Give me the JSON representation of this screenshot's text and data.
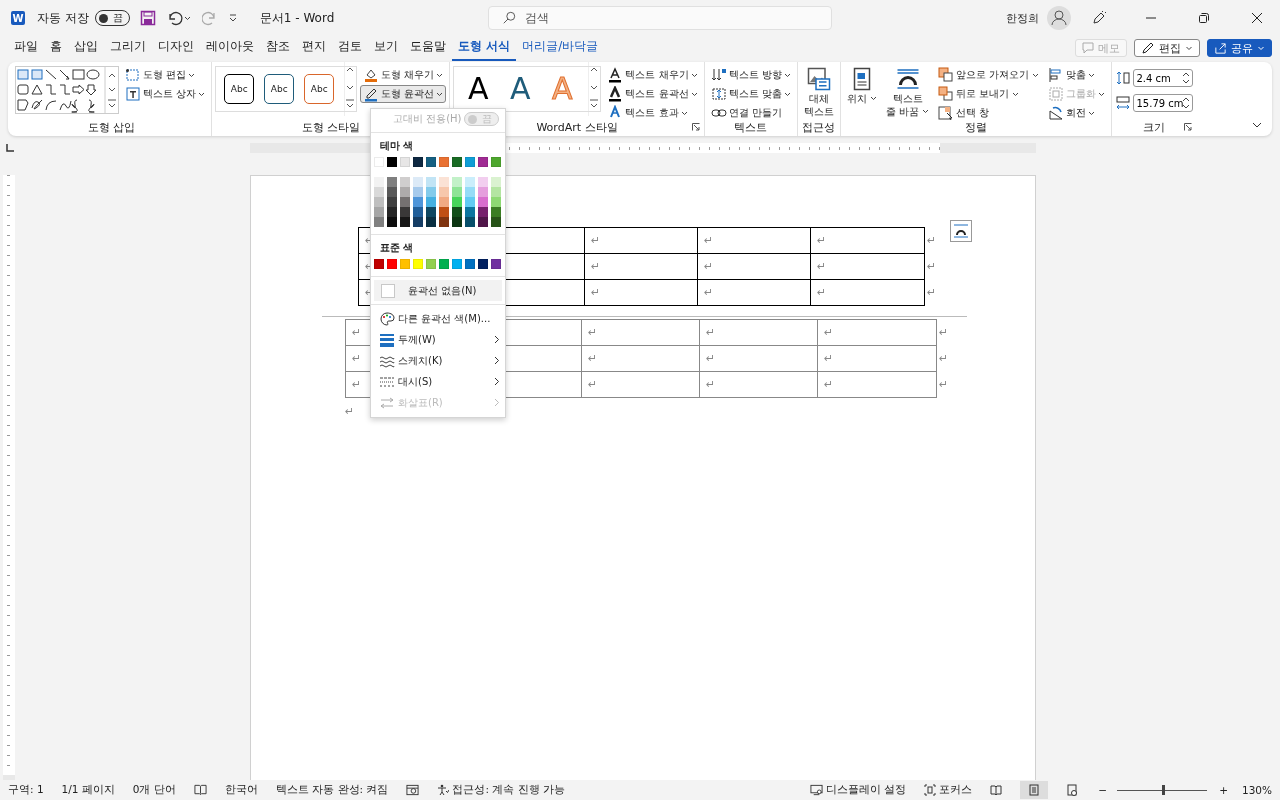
{
  "title_bar": {
    "logo_letter": "W",
    "autosave_label": "자동 저장",
    "autosave_toggle": {
      "label": "끔",
      "on": false
    },
    "document_title": "문서1  -  Word",
    "search": {
      "placeholder": "검색"
    },
    "user_name": "한정희"
  },
  "tabs": [
    {
      "label": "파일",
      "selected": false,
      "kind": "normal"
    },
    {
      "label": "홈",
      "selected": false,
      "kind": "normal"
    },
    {
      "label": "삽입",
      "selected": false,
      "kind": "normal"
    },
    {
      "label": "그리기",
      "selected": false,
      "kind": "normal"
    },
    {
      "label": "디자인",
      "selected": false,
      "kind": "normal"
    },
    {
      "label": "레이아웃",
      "selected": false,
      "kind": "normal"
    },
    {
      "label": "참조",
      "selected": false,
      "kind": "normal"
    },
    {
      "label": "편지",
      "selected": false,
      "kind": "normal"
    },
    {
      "label": "검토",
      "selected": false,
      "kind": "normal"
    },
    {
      "label": "보기",
      "selected": false,
      "kind": "normal"
    },
    {
      "label": "도움말",
      "selected": false,
      "kind": "normal"
    },
    {
      "label": "도형 서식",
      "selected": true,
      "kind": "contextual"
    },
    {
      "label": "머리글/바닥글",
      "selected": false,
      "kind": "contextual"
    }
  ],
  "actions": [
    {
      "label": "메모",
      "kind": "comment",
      "disabled": true
    },
    {
      "label": "편집",
      "kind": "edit",
      "disabled": false
    },
    {
      "label": "공유",
      "kind": "share",
      "disabled": false
    }
  ],
  "ribbon": {
    "groups": [
      {
        "label": "도형 삽입",
        "launcher": false,
        "columns": [
          [
            {
              "kind": "shape-gallery"
            }
          ],
          [
            {
              "kind": "button",
              "text": "도형 편집",
              "dropdown": true,
              "pressed": false,
              "disabled": false
            },
            {
              "kind": "button",
              "text": "텍스트 상자",
              "dropdown": true,
              "pressed": false,
              "disabled": false
            }
          ]
        ]
      },
      {
        "label": "도형 스타일",
        "launcher": false,
        "columns": [
          [
            {
              "kind": "style-gallery",
              "styles": [
                {
                  "text": "Abc",
                  "color": "#000000"
                },
                {
                  "text": "Abc",
                  "color": "#1f5c7a"
                },
                {
                  "text": "Abc",
                  "color": "#d9662b"
                }
              ]
            }
          ],
          [
            {
              "kind": "button",
              "text": "도형 채우기",
              "dropdown": true,
              "pressed": false,
              "disabled": false
            },
            {
              "kind": "button",
              "text": "도형 윤곽선",
              "dropdown": true,
              "pressed": true,
              "disabled": false
            }
          ]
        ]
      },
      {
        "label": "WordArt 스타일",
        "launcher": true,
        "columns": [
          [
            {
              "kind": "wordart-gallery",
              "letters": [
                {
                  "text": "A",
                  "color": "#000000",
                  "kind": "solid"
                },
                {
                  "text": "A",
                  "color": "#1f5c7a",
                  "kind": "solid"
                },
                {
                  "text": "A",
                  "color": "#f4b183",
                  "kind": "outline"
                }
              ]
            }
          ],
          [
            {
              "kind": "button",
              "text": "텍스트 채우기",
              "dropdown": true,
              "pressed": false,
              "disabled": false
            },
            {
              "kind": "button",
              "text": "텍스트 윤곽선",
              "dropdown": true,
              "pressed": false,
              "disabled": false
            },
            {
              "kind": "button",
              "text": "텍스트 효과",
              "dropdown": true,
              "pressed": false,
              "disabled": false
            }
          ]
        ]
      },
      {
        "label": "텍스트",
        "launcher": false,
        "columns": [
          [
            {
              "kind": "button",
              "text": "텍스트 방향",
              "dropdown": true,
              "pressed": false,
              "disabled": false
            },
            {
              "kind": "button",
              "text": "텍스트 맞춤",
              "dropdown": true,
              "pressed": false,
              "disabled": false
            },
            {
              "kind": "button",
              "text": "연결 만들기",
              "dropdown": false,
              "pressed": false,
              "disabled": false
            }
          ]
        ]
      },
      {
        "label": "접근성",
        "launcher": false,
        "columns": [
          [
            {
              "kind": "large-button",
              "lines": [
                "대체",
                "텍스트"
              ],
              "dropdown": false,
              "pressed": false,
              "disabled": false
            }
          ]
        ]
      },
      {
        "label": "정렬",
        "launcher": false,
        "columns": [
          [
            {
              "kind": "large-button",
              "lines": [
                "위치"
              ],
              "dropdown": true,
              "pressed": false,
              "disabled": false
            }
          ],
          [
            {
              "kind": "large-button",
              "lines": [
                "텍스트",
                "줄 바꿈"
              ],
              "dropdown": true,
              "pressed": false,
              "disabled": false
            }
          ],
          [
            {
              "kind": "button",
              "text": "앞으로 가져오기",
              "dropdown": true,
              "pressed": false,
              "disabled": false
            },
            {
              "kind": "button",
              "text": "뒤로 보내기",
              "dropdown": true,
              "pressed": false,
              "disabled": false
            },
            {
              "kind": "button",
              "text": "선택 창",
              "dropdown": false,
              "pressed": false,
              "disabled": false
            }
          ],
          [
            {
              "kind": "button",
              "text": "맞춤",
              "dropdown": true,
              "pressed": false,
              "disabled": false
            },
            {
              "kind": "button",
              "text": "그룹화",
              "dropdown": true,
              "pressed": false,
              "disabled": true
            },
            {
              "kind": "button",
              "text": "회전",
              "dropdown": true,
              "pressed": false,
              "disabled": false
            }
          ]
        ]
      },
      {
        "label": "크기",
        "launcher": true,
        "columns": [
          [
            {
              "kind": "field",
              "value": "2.4 cm"
            },
            {
              "kind": "field",
              "value": "15.79 cm"
            }
          ]
        ]
      }
    ]
  },
  "menu": {
    "high_contrast": {
      "label": "고대비 전용(H)",
      "toggle": "끔",
      "on": false,
      "disabled": true
    },
    "theme_heading": "테마 색",
    "theme_colors": [
      {
        "color": "#ffffff",
        "shades": [
          {
            "color": "#f2f2f2"
          },
          {
            "color": "#d9d9d9"
          },
          {
            "color": "#bfbfbf"
          },
          {
            "color": "#a6a6a6"
          },
          {
            "color": "#808080"
          }
        ]
      },
      {
        "color": "#000000",
        "shades": [
          {
            "color": "#7f7f7f"
          },
          {
            "color": "#595959"
          },
          {
            "color": "#404040"
          },
          {
            "color": "#262626"
          },
          {
            "color": "#0d0d0d"
          }
        ]
      },
      {
        "color": "#e7e6e6",
        "shades": [
          {
            "color": "#d0cece"
          },
          {
            "color": "#aeabab"
          },
          {
            "color": "#757171"
          },
          {
            "color": "#3a3838"
          },
          {
            "color": "#171616"
          }
        ]
      },
      {
        "color": "#0e2841",
        "shades": [
          {
            "color": "#dceaf7"
          },
          {
            "color": "#a6caec"
          },
          {
            "color": "#4e95d9"
          },
          {
            "color": "#215f9a"
          },
          {
            "color": "#153d64"
          }
        ]
      },
      {
        "color": "#156082",
        "shades": [
          {
            "color": "#c1e4f5"
          },
          {
            "color": "#83cbeb"
          },
          {
            "color": "#45b0e1"
          },
          {
            "color": "#0f4761"
          },
          {
            "color": "#0a2f41"
          }
        ]
      },
      {
        "color": "#e97132",
        "shades": [
          {
            "color": "#fbe2d5"
          },
          {
            "color": "#f7c7ac"
          },
          {
            "color": "#f1a983"
          },
          {
            "color": "#c04f15"
          },
          {
            "color": "#803410"
          }
        ]
      },
      {
        "color": "#196b24",
        "shades": [
          {
            "color": "#c2f1c8"
          },
          {
            "color": "#8ee496"
          },
          {
            "color": "#47d45a"
          },
          {
            "color": "#124f1a"
          },
          {
            "color": "#0c3512"
          }
        ]
      },
      {
        "color": "#0f9ed5",
        "shades": [
          {
            "color": "#caeefb"
          },
          {
            "color": "#95dcf7"
          },
          {
            "color": "#61cbf3"
          },
          {
            "color": "#0b76a0"
          },
          {
            "color": "#074f6a"
          }
        ]
      },
      {
        "color": "#a02b93",
        "shades": [
          {
            "color": "#f2ceef"
          },
          {
            "color": "#e59edd"
          },
          {
            "color": "#d86dcd"
          },
          {
            "color": "#77206d"
          },
          {
            "color": "#501549"
          }
        ]
      },
      {
        "color": "#4ea72e",
        "shades": [
          {
            "color": "#daf2d0"
          },
          {
            "color": "#b4e5a2"
          },
          {
            "color": "#8ed973"
          },
          {
            "color": "#3b7d23"
          },
          {
            "color": "#275317"
          }
        ]
      }
    ],
    "standard_heading": "표준 색",
    "standard_colors": [
      {
        "color": "#c00000"
      },
      {
        "color": "#ff0000"
      },
      {
        "color": "#ffc000"
      },
      {
        "color": "#ffff00"
      },
      {
        "color": "#92d050"
      },
      {
        "color": "#00b050"
      },
      {
        "color": "#00b0f0"
      },
      {
        "color": "#0070c0"
      },
      {
        "color": "#002060"
      },
      {
        "color": "#7030a0"
      }
    ],
    "items": [
      {
        "label": "윤곽선 없음(N)",
        "kind": "no-outline",
        "submenu": false,
        "disabled": false,
        "hovered": true
      },
      {
        "label": "다른 윤곽선 색(M)...",
        "kind": "more-colors",
        "submenu": false,
        "disabled": false,
        "hovered": false
      },
      {
        "label": "두께(W)",
        "kind": "weight",
        "submenu": true,
        "disabled": false,
        "hovered": false
      },
      {
        "label": "스케치(K)",
        "kind": "sketch",
        "submenu": true,
        "disabled": false,
        "hovered": false
      },
      {
        "label": "대시(S)",
        "kind": "dash",
        "submenu": true,
        "disabled": false,
        "hovered": false
      },
      {
        "label": "화살표(R)",
        "kind": "arrows",
        "submenu": true,
        "disabled": true,
        "hovered": false
      }
    ]
  },
  "document": {
    "tables": [
      {
        "rows": [
          {
            "cells": [
              "↵",
              null,
              "↵",
              "↵",
              "↵"
            ],
            "end_mark": "↵"
          },
          {
            "cells": [
              "↵",
              null,
              "↵",
              "↵",
              "↵"
            ],
            "end_mark": "↵"
          },
          {
            "cells": [
              "↵",
              null,
              "↵",
              "↵",
              "↵"
            ],
            "end_mark": "↵"
          }
        ]
      },
      {
        "rows": [
          {
            "cells": [
              "↵",
              null,
              "↵",
              "↵",
              "↵"
            ],
            "end_mark": "↵"
          },
          {
            "cells": [
              "↵",
              null,
              "↵",
              "↵",
              "↵"
            ],
            "end_mark": "↵"
          },
          {
            "cells": [
              "↵",
              null,
              "↵",
              "↵",
              "↵"
            ],
            "end_mark": "↵"
          }
        ]
      }
    ],
    "paragraph_mark": "↵"
  },
  "status_bar": {
    "left": [
      {
        "text": "구역: 1",
        "kind": "text"
      },
      {
        "text": "1/1 페이지",
        "kind": "text"
      },
      {
        "text": "0개 단어",
        "kind": "text"
      },
      {
        "kind": "proofing"
      },
      {
        "text": "한국어",
        "kind": "text"
      },
      {
        "text": "텍스트 자동 완성: 켜짐",
        "kind": "text"
      },
      {
        "kind": "macro"
      },
      {
        "text": "접근성: 계속 진행 가능",
        "kind": "accessibility"
      }
    ],
    "display_settings": "디스플레이 설정",
    "focus": "포커스",
    "views": [
      {
        "kind": "read",
        "selected": false
      },
      {
        "kind": "print",
        "selected": true
      },
      {
        "kind": "web",
        "selected": false
      }
    ],
    "zoom_out": "−",
    "zoom_in": "+",
    "zoom": {
      "level": 0.51
    },
    "zoom_text": "130%"
  }
}
